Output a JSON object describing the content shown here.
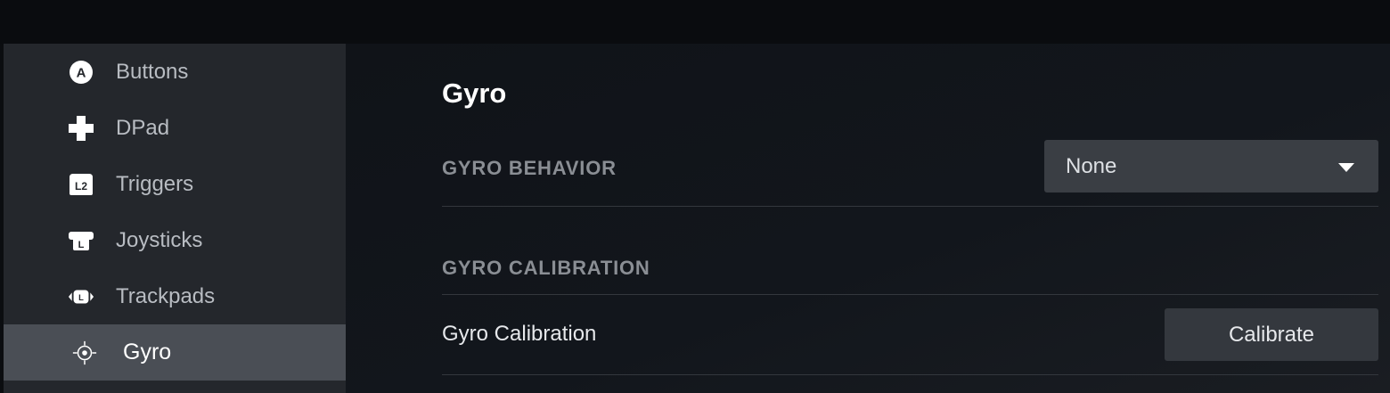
{
  "sidebar": {
    "items": [
      {
        "label": "Buttons",
        "icon": "a-button-icon"
      },
      {
        "label": "DPad",
        "icon": "dpad-icon"
      },
      {
        "label": "Triggers",
        "icon": "l2-trigger-icon"
      },
      {
        "label": "Joysticks",
        "icon": "joystick-icon"
      },
      {
        "label": "Trackpads",
        "icon": "trackpad-icon"
      },
      {
        "label": "Gyro",
        "icon": "gyro-icon",
        "active": true
      }
    ]
  },
  "icons": {
    "a_button_text": "A",
    "l2_text": "L2",
    "joystick_text": "L",
    "trackpad_text": "L"
  },
  "main": {
    "title": "Gyro",
    "gyro_behavior": {
      "section_label": "GYRO BEHAVIOR",
      "selected": "None"
    },
    "gyro_calibration": {
      "section_label": "GYRO CALIBRATION",
      "row_label": "Gyro Calibration",
      "button_label": "Calibrate"
    }
  },
  "colors": {
    "active_item_bg": "#4a4e55",
    "sidebar_bg": "#24272c",
    "content_bg": "#12161c"
  }
}
